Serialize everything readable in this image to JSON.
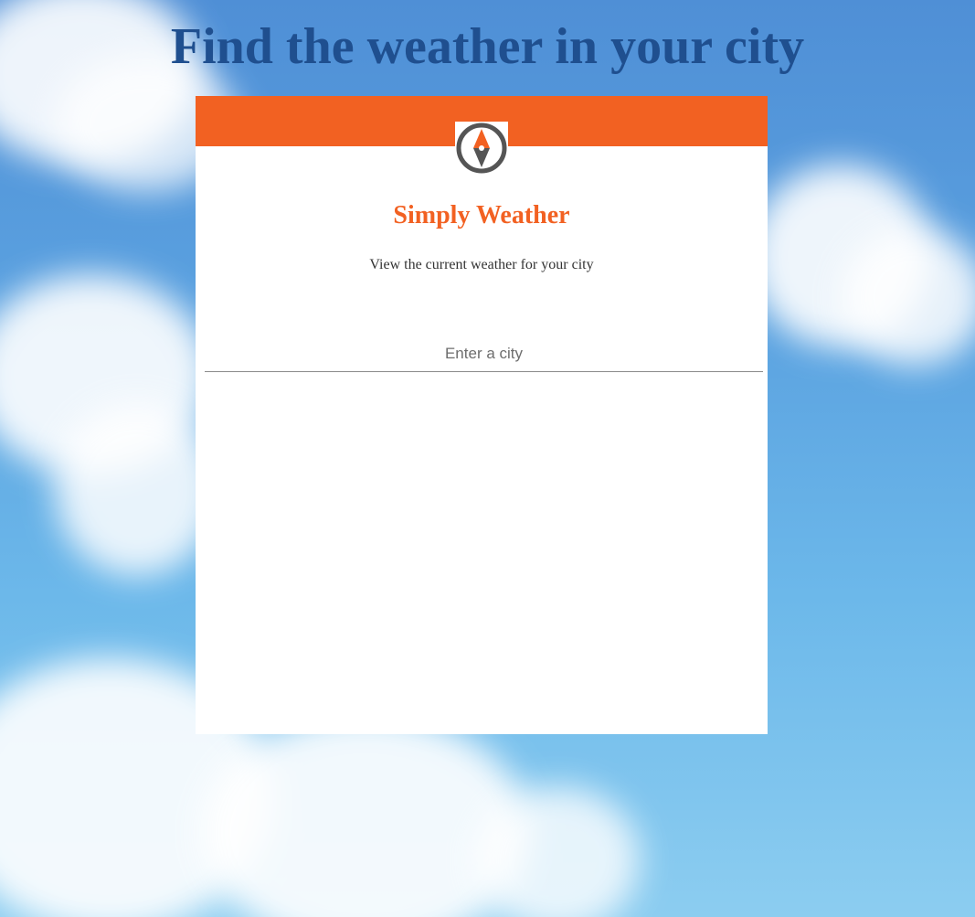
{
  "page": {
    "title": "Find the weather in your city"
  },
  "card": {
    "brand": "Simply Weather",
    "tagline": "View the current weather for your city",
    "city_input": {
      "placeholder": "Enter a city",
      "value": ""
    },
    "logo_icon": "compass-icon"
  },
  "colors": {
    "accent": "#f26122",
    "title": "#1f4f8f",
    "sky_top": "#4f8fd6",
    "sky_bottom": "#8ccdf0"
  }
}
